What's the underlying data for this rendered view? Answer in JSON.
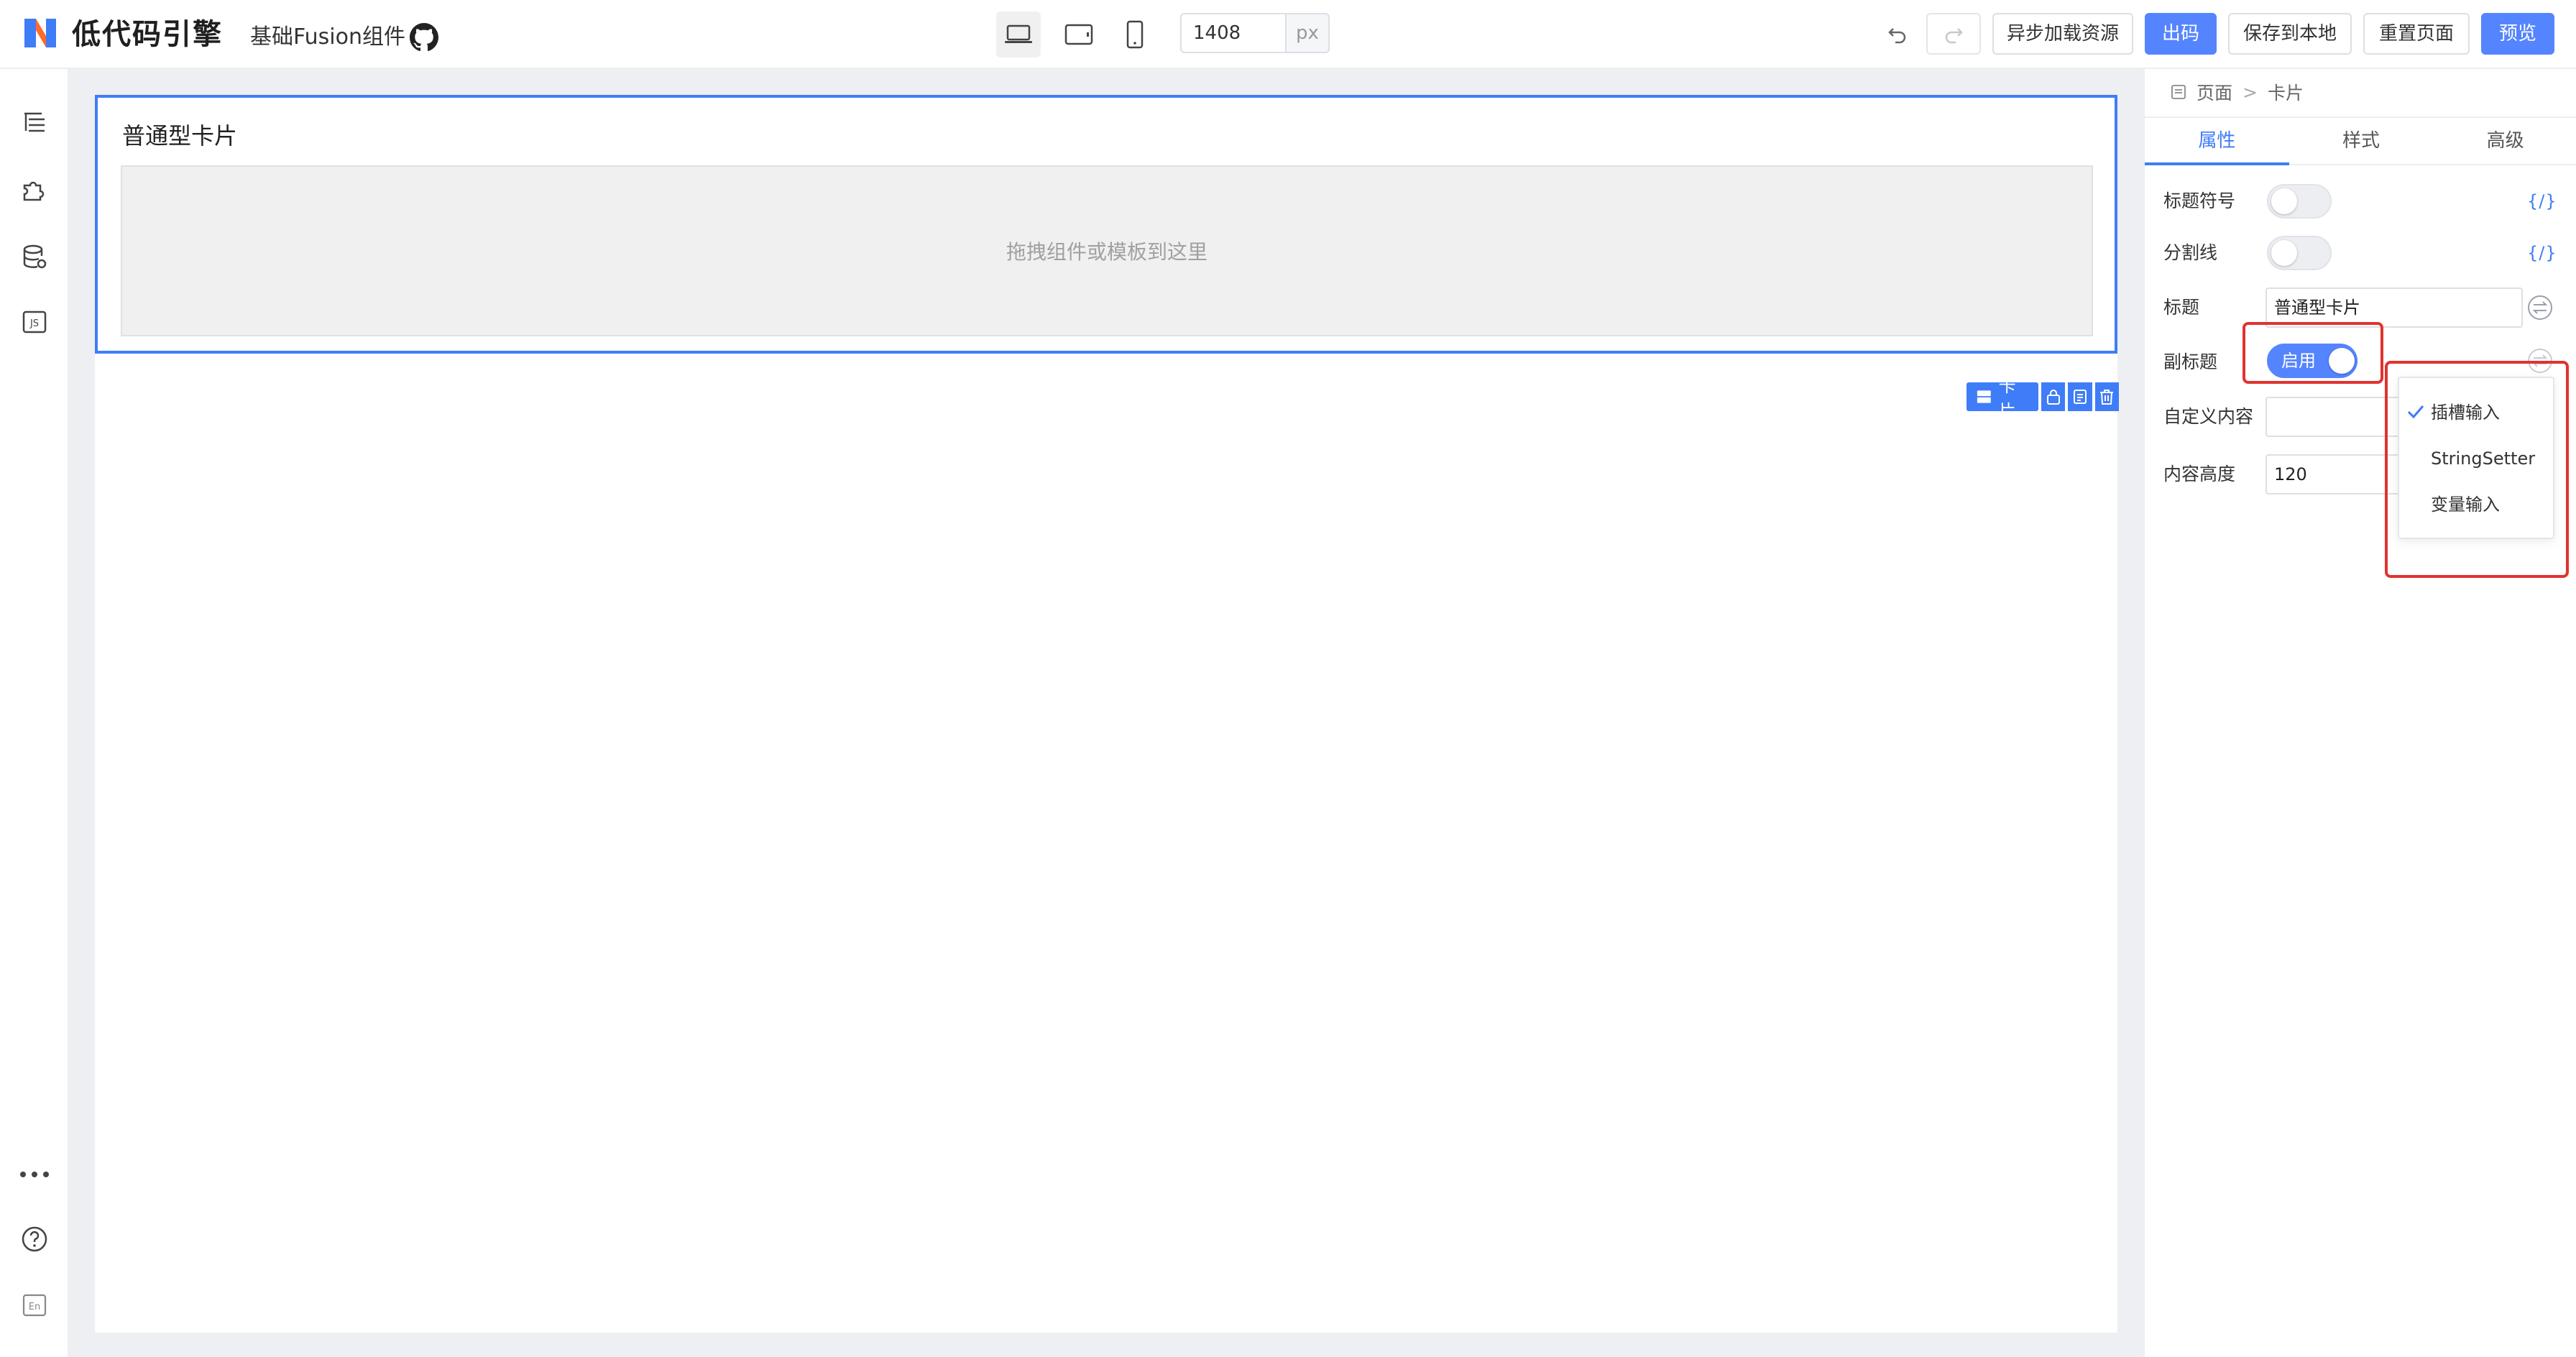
{
  "header": {
    "brand": "低代码引擎",
    "project": "基础Fusion组件",
    "canvas_width_value": "1408",
    "canvas_width_unit": "px",
    "buttons": {
      "async_load": "异步加载资源",
      "export_code": "出码",
      "save_local": "保存到本地",
      "reset_page": "重置页面",
      "preview": "预览"
    }
  },
  "canvas": {
    "card_title": "普通型卡片",
    "dropzone_text": "拖拽组件或模板到这里",
    "selection_label": "卡片"
  },
  "panel": {
    "breadcrumb": [
      "页面",
      "卡片"
    ],
    "tabs": [
      "属性",
      "样式",
      "高级"
    ],
    "code_toggle": "{/}",
    "props": {
      "title_symbol": "标题符号",
      "divider": "分割线",
      "title": "标题",
      "title_value": "普通型卡片",
      "subtitle": "副标题",
      "subtitle_switch": "启用",
      "custom_content": "自定义内容",
      "content_height": "内容高度",
      "content_height_value": "120"
    },
    "setter_menu": [
      "插槽输入",
      "StringSetter",
      "变量输入"
    ]
  },
  "colors": {
    "accent": "#5584ff",
    "selection": "#3f7cf7",
    "highlight": "#e0332f"
  }
}
